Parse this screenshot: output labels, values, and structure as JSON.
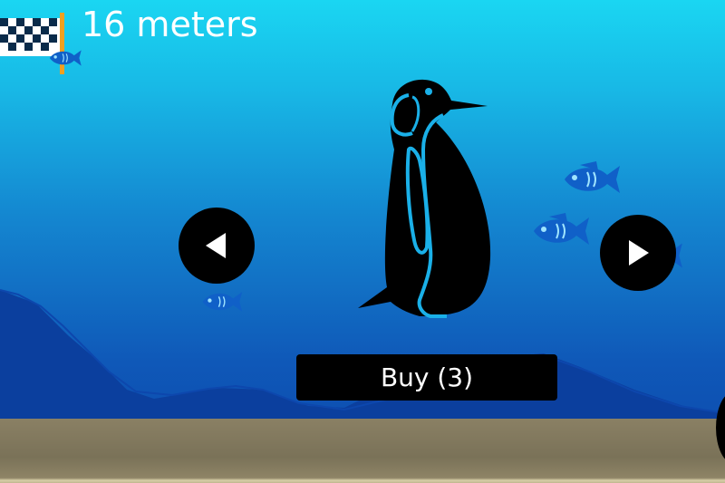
{
  "hud": {
    "distance_text": "16 meters",
    "flag_icon": "checkered-flag-icon"
  },
  "shop": {
    "buy_label": "Buy (3)",
    "prev_icon": "arrow-left-icon",
    "next_icon": "arrow-right-icon",
    "character_icon": "penguin-icon"
  },
  "colors": {
    "sky_top": "#1ad6f2",
    "water_deep": "#0c47aa",
    "hills": "#0b3f9e",
    "fish": "#1060c8",
    "ground": "#7a7258",
    "penguin_body": "#000000",
    "penguin_outline": "#1ab0e8"
  },
  "fish_icons": [
    "fish-icon",
    "fish-icon",
    "fish-icon",
    "fish-icon",
    "fish-icon"
  ]
}
